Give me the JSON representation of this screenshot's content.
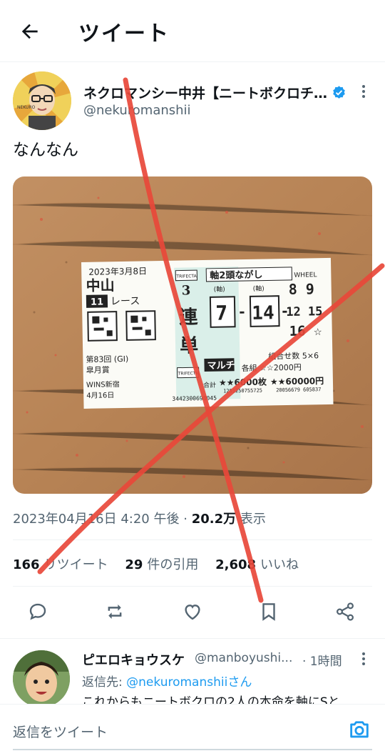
{
  "header": {
    "title": "ツイート",
    "back_icon": "arrow-left-icon"
  },
  "tweet": {
    "display_name": "ネクロマンシー中井【ニートボクロチ…",
    "handle": "@nekuromanshii",
    "verified": true,
    "text": "なんなん",
    "timestamp": "2023年04月16日 4:20 午後",
    "separator": "·",
    "views_count": "20.2万",
    "views_label": "表示",
    "retweets_count": "166",
    "retweets_label": "リツイート",
    "quotes_count": "29",
    "quotes_label": "件の引用",
    "likes_count": "2,608",
    "likes_label": "いいね"
  },
  "ticket": {
    "date": "2023年3月8日",
    "venue": "中山",
    "race_no": "11",
    "race_label": "レース",
    "bet_type_num": "3",
    "bet_type_a": "連",
    "bet_type_b": "単",
    "trifecta": "TRIFECTA",
    "method": "軸2頭ながし",
    "wheel": "WHEEL",
    "axis1_label": "(軸)",
    "axis2_label": "(軸)",
    "first": "7",
    "dash": "-",
    "second": "14",
    "others_top": "8 9",
    "others_mid": "12 15",
    "others_bot": "16 ☆",
    "multi": "マルチ",
    "combos": "組合せ数 5×6",
    "each": "各組 ☆☆2000円",
    "total_label": "合計",
    "total_tickets": "★★6000枚",
    "total_yen": "★★60000円",
    "event": "第83回 (GI)",
    "event_name": "皐月賞",
    "office": "WINS新宿",
    "office_date": "4月16日",
    "serial1": "3442300698045",
    "serial2": "1291250755725",
    "serial3": "20056679 605837"
  },
  "actions": {
    "reply_icon": "reply-icon",
    "retweet_icon": "retweet-icon",
    "like_icon": "heart-icon",
    "bookmark_icon": "bookmark-icon",
    "share_icon": "share-icon"
  },
  "reply": {
    "display_name": "ピエロキョウスケ",
    "handle": "@manboyushi...",
    "time": "· 1時間",
    "reply_to_prefix": "返信先: ",
    "reply_to_handle": "@nekuromanshiiさん",
    "body": "これからもニートボクロの2人の本命を軸にSと"
  },
  "composer": {
    "placeholder": "返信をツイート",
    "camera_icon": "camera-icon"
  },
  "colors": {
    "accent": "#1d9bf0",
    "text": "#0f1419",
    "muted": "#536471",
    "red_mark": "#e8483a",
    "wood": "#b9855a"
  }
}
